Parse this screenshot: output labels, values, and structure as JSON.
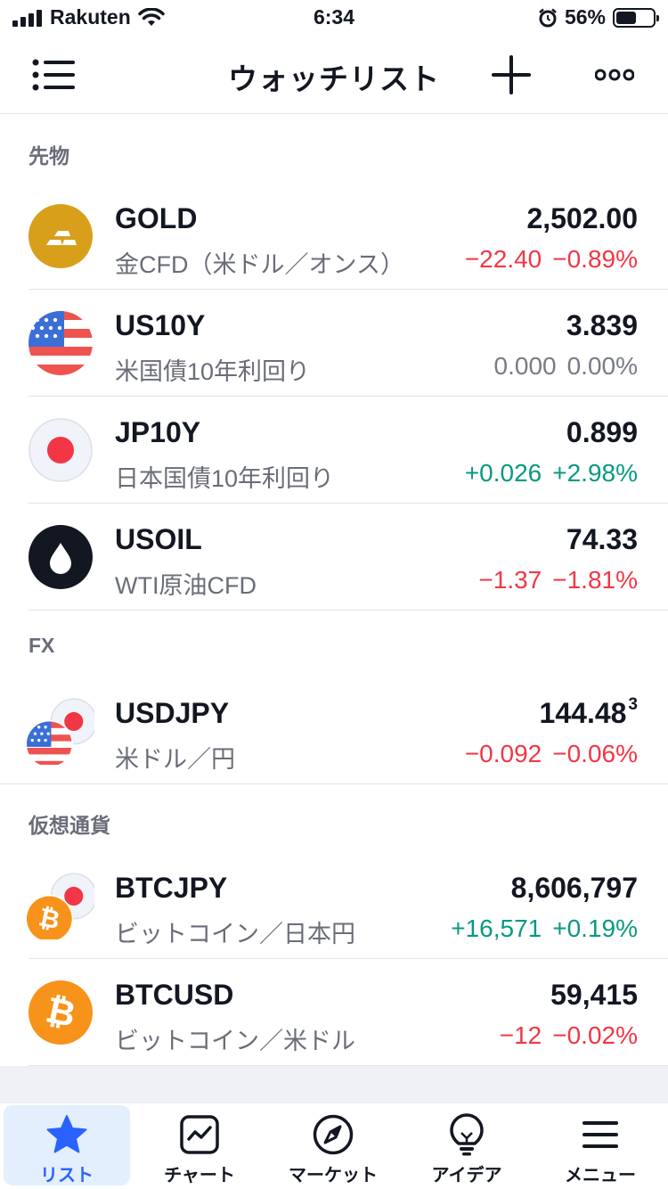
{
  "status_bar": {
    "carrier": "Rakuten",
    "time": "6:34",
    "battery": "56%",
    "battery_level": 0.56
  },
  "nav": {
    "title": "ウォッチリスト"
  },
  "sections": [
    {
      "header": "先物",
      "rows": [
        {
          "symbol": "GOLD",
          "description": "金CFD（米ドル／オンス）",
          "price": "2,502.00",
          "price_sup": "",
          "change": "−22.40",
          "change_pct": "−0.89%",
          "trend": "neg",
          "icon": "gold-bars-icon"
        },
        {
          "symbol": "US10Y",
          "description": "米国債10年利回り",
          "price": "3.839",
          "price_sup": "",
          "change": "0.000",
          "change_pct": "0.00%",
          "trend": "zero",
          "icon": "us-flag-icon"
        },
        {
          "symbol": "JP10Y",
          "description": "日本国債10年利回り",
          "price": "0.899",
          "price_sup": "",
          "change": "+0.026",
          "change_pct": "+2.98%",
          "trend": "pos",
          "icon": "japan-flag-icon"
        },
        {
          "symbol": "USOIL",
          "description": "WTI原油CFD",
          "price": "74.33",
          "price_sup": "",
          "change": "−1.37",
          "change_pct": "−1.81%",
          "trend": "neg",
          "icon": "oil-drop-icon"
        }
      ]
    },
    {
      "header": "FX",
      "rows": [
        {
          "symbol": "USDJPY",
          "description": "米ドル／円",
          "price": "144.48",
          "price_sup": "3",
          "change": "−0.092",
          "change_pct": "−0.06%",
          "trend": "neg",
          "icon": "usd-jpy-flags-icon"
        }
      ]
    },
    {
      "header": "仮想通貨",
      "rows": [
        {
          "symbol": "BTCJPY",
          "description": "ビットコイン／日本円",
          "price": "8,606,797",
          "price_sup": "",
          "change": "+16,571",
          "change_pct": "+0.19%",
          "trend": "pos",
          "icon": "btc-jpy-icon"
        },
        {
          "symbol": "BTCUSD",
          "description": "ビットコイン／米ドル",
          "price": "59,415",
          "price_sup": "",
          "change": "−12",
          "change_pct": "−0.02%",
          "trend": "neg",
          "icon": "bitcoin-icon"
        }
      ]
    }
  ],
  "tabbar": {
    "tabs": [
      {
        "label": "リスト",
        "icon": "star-icon",
        "active": true
      },
      {
        "label": "チャート",
        "icon": "chart-icon",
        "active": false
      },
      {
        "label": "マーケット",
        "icon": "compass-icon",
        "active": false
      },
      {
        "label": "アイデア",
        "icon": "lightbulb-icon",
        "active": false
      },
      {
        "label": "メニュー",
        "icon": "menu-icon",
        "active": false
      }
    ]
  },
  "colors": {
    "negative": "#f23645",
    "positive": "#089981",
    "neutral": "#787b86",
    "accent": "#2962ff",
    "gold": "#d89f1b",
    "bitcoin": "#f7931a"
  }
}
